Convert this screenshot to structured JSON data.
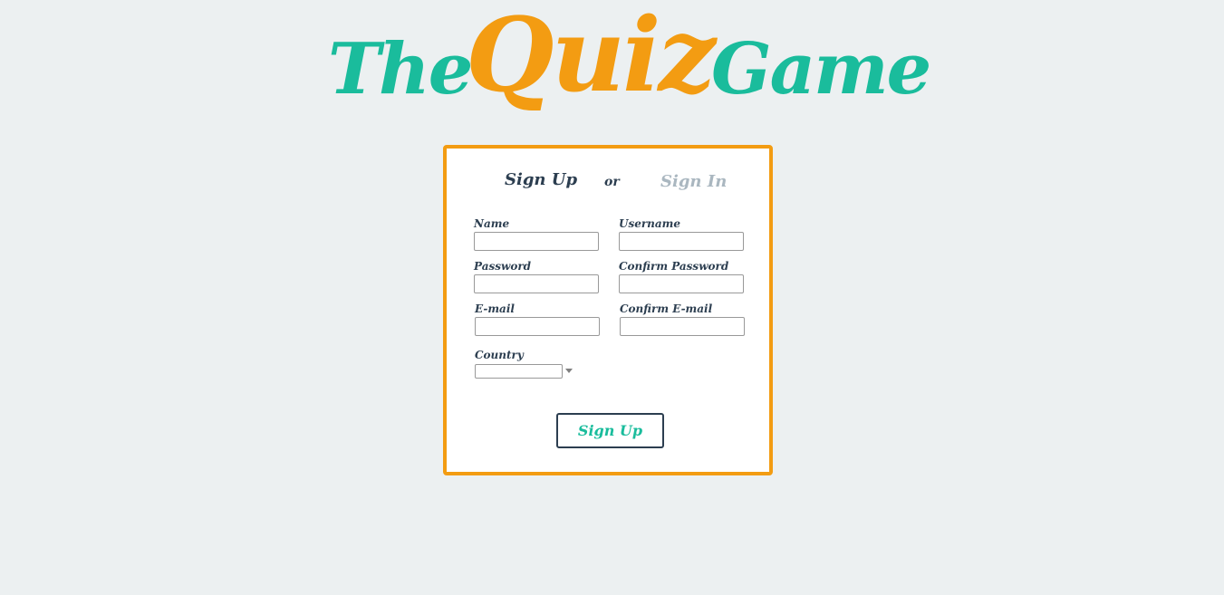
{
  "logo": {
    "the": "The",
    "quiz": "Quiz",
    "game": "Game"
  },
  "colors": {
    "background": "#ecf0f1",
    "teal": "#1abc9c",
    "orange": "#f39c12",
    "navy": "#2c3e50",
    "muted": "#aab7c0"
  },
  "tabs": {
    "sign_up": "Sign Up",
    "or": "or",
    "sign_in": "Sign In"
  },
  "form": {
    "name": {
      "label": "Name",
      "value": ""
    },
    "username": {
      "label": "Username",
      "value": ""
    },
    "password": {
      "label": "Password",
      "value": ""
    },
    "confirm_password": {
      "label": "Confirm Password",
      "value": ""
    },
    "email": {
      "label": "E-mail",
      "value": ""
    },
    "confirm_email": {
      "label": "Confirm E-mail",
      "value": ""
    },
    "country": {
      "label": "Country",
      "selected": ""
    },
    "submit_label": "Sign Up"
  }
}
